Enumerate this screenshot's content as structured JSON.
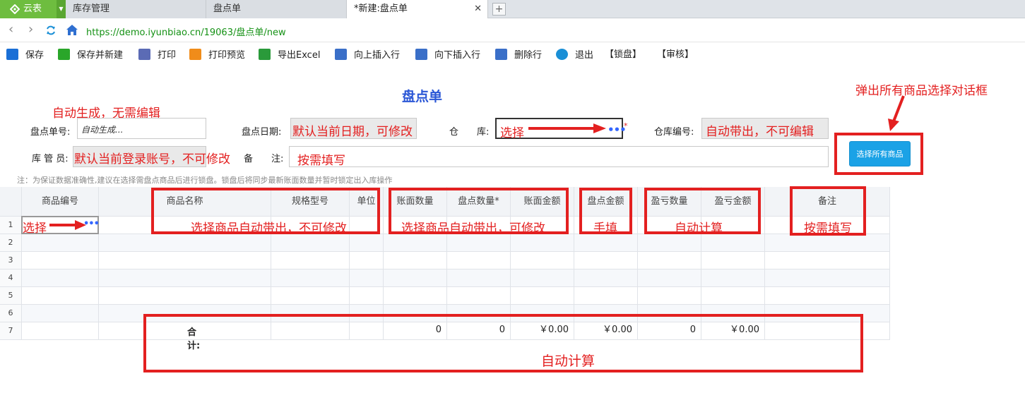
{
  "browser": {
    "brand": "云表",
    "tabs": [
      "库存管理",
      "盘点单",
      "*新建:盘点单"
    ],
    "url": "https://demo.iyunbiao.cn/19063/盘点单/new"
  },
  "toolbar": [
    {
      "label": "保存",
      "icon": "save-icon",
      "color": "#1a6fd6"
    },
    {
      "label": "保存并新建",
      "icon": "save-new-icon",
      "color": "#2aa62a"
    },
    {
      "label": "打印",
      "icon": "printer-icon",
      "color": "#5b6bb5"
    },
    {
      "label": "打印预览",
      "icon": "print-preview-icon",
      "color": "#f08c1a"
    },
    {
      "label": "导出Excel",
      "icon": "excel-icon",
      "color": "#2a9a3a"
    },
    {
      "label": "向上插入行",
      "icon": "insert-above-icon",
      "color": "#3a6fc8"
    },
    {
      "label": "向下插入行",
      "icon": "insert-below-icon",
      "color": "#3a6fc8"
    },
    {
      "label": "删除行",
      "icon": "delete-row-icon",
      "color": "#3a6fc8"
    },
    {
      "label": "退出",
      "icon": "power-icon",
      "color": "#1a8fd6"
    },
    {
      "label": "【锁盘】",
      "icon": "",
      "color": ""
    },
    {
      "label": "【审核】",
      "icon": "",
      "color": ""
    }
  ],
  "form": {
    "title": "盘点单",
    "doc_no_label": "盘点单号:",
    "doc_no_value": "自动生成...",
    "date_label": "盘点日期:",
    "warehouse_label": "仓　　库:",
    "warehouse_no_label": "仓库编号:",
    "keeper_label": "库 管 员:",
    "remark_label": "备　　注:",
    "select_all_button": "选择所有商品",
    "note": "注：为保证数据准确性,建议在选择需盘点商品后进行锁盘。锁盘后将同步最新账面数量并暂时锁定出入库操作"
  },
  "grid": {
    "columns": [
      "商品编号",
      "商品名称",
      "规格型号",
      "单位",
      "账面数量",
      "盘点数量*",
      "账面金额",
      "盘点金额",
      "盈亏数量",
      "盈亏金额",
      "备注"
    ],
    "row_numbers": [
      "1",
      "2",
      "3",
      "4",
      "5",
      "6",
      "7"
    ],
    "total_label": "合计:",
    "totals": {
      "book_qty": "0",
      "count_qty": "0",
      "book_amount": "￥0.00",
      "count_amount": "￥0.00",
      "diff_qty": "0",
      "diff_amount": "￥0.00"
    }
  },
  "annotations": {
    "auto_generated": "自动生成，无需编辑",
    "default_date": "默认当前日期，可修改",
    "select_warehouse": "选择",
    "auto_fill_readonly": "自动带出，不可编辑",
    "default_user": "默认当前登录账号，不可修改",
    "remark_hint": "按需填写",
    "popup_dialog": "弹出所有商品选择对话框",
    "row_select": "选择",
    "name_auto": "选择商品自动带出，不可修改",
    "qty_auto": "选择商品自动带出，可修改",
    "manual_fill": "手填",
    "auto_calc": "自动计算",
    "remark_fill": "按需填写",
    "total_auto_calc": "自动计算",
    "required_mark": "*"
  },
  "colors": {
    "accent_blue": "#2b57d6",
    "annotation_red": "#e32020",
    "button_blue": "#1ba2e6",
    "brand_green": "#6ebd3f"
  }
}
